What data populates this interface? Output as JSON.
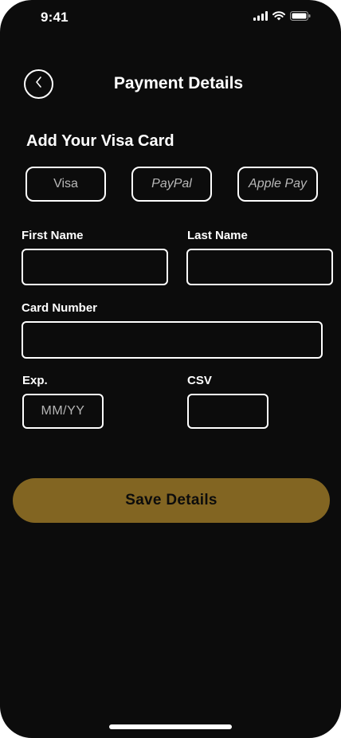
{
  "status_bar": {
    "time": "9:41",
    "icons": [
      "cellular-signal-icon",
      "wifi-icon",
      "battery-icon"
    ]
  },
  "header": {
    "back_icon": "chevron-left-icon",
    "title": "Payment Details"
  },
  "section_title": "Add Your Visa Card",
  "payment_methods": [
    {
      "label": "Visa"
    },
    {
      "label": "PayPal"
    },
    {
      "label": "Apple Pay"
    }
  ],
  "form": {
    "first_name": {
      "label": "First Name",
      "value": "",
      "placeholder": ""
    },
    "last_name": {
      "label": "Last Name",
      "value": "",
      "placeholder": ""
    },
    "card_number": {
      "label": "Card Number",
      "value": "",
      "placeholder": ""
    },
    "expiry": {
      "label": "Exp.",
      "value": "",
      "placeholder": "MM/YY"
    },
    "csv": {
      "label": "CSV",
      "value": "",
      "placeholder": ""
    }
  },
  "save_button": {
    "label": "Save Details"
  },
  "colors": {
    "background": "#0c0c0c",
    "accent": "#826522",
    "border": "#ffffff",
    "muted_text": "#b8b8b8"
  }
}
